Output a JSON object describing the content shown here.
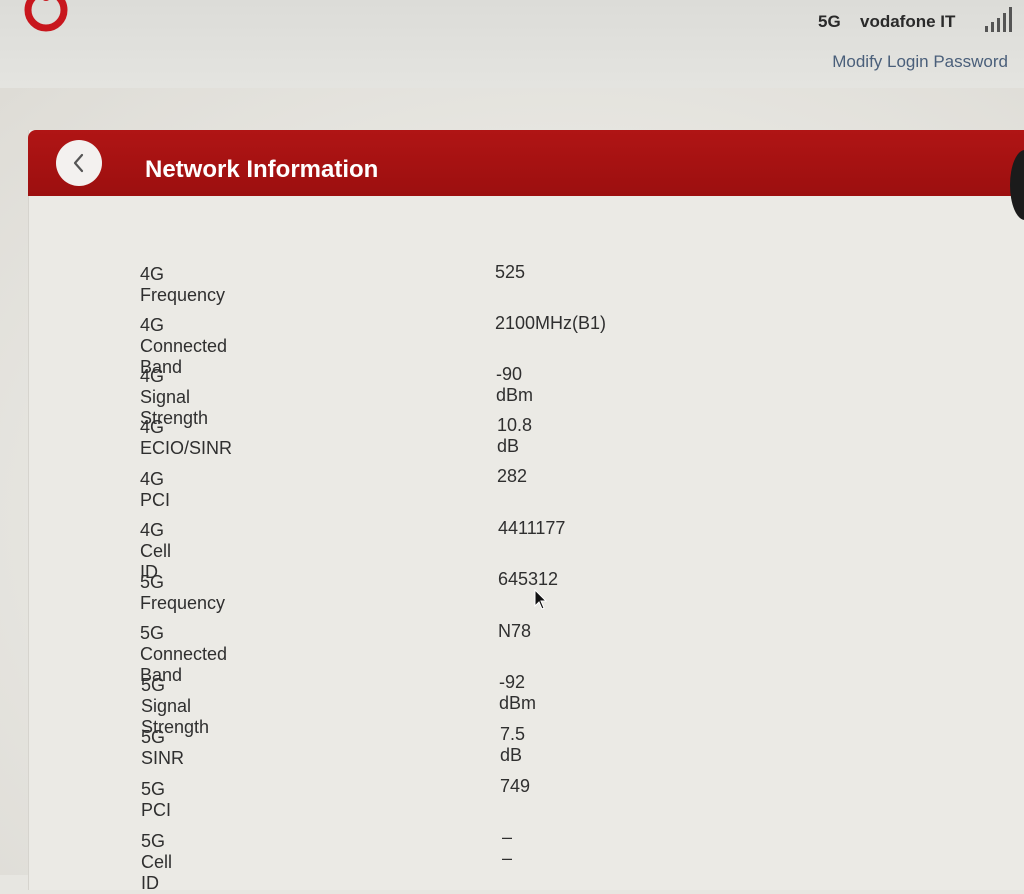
{
  "header": {
    "network_mode": "5G",
    "carrier": "vodafone IT",
    "modify_password_label": "Modify Login Password"
  },
  "panel": {
    "title": "Network Information"
  },
  "info_rows": [
    {
      "label": "4G Frequency",
      "value": "525"
    },
    {
      "label": "4G Connected Band",
      "value": "2100MHz(B1)"
    },
    {
      "label": "4G Signal Strength",
      "value": "-90 dBm"
    },
    {
      "label": "4G ECIO/SINR",
      "value": "10.8 dB"
    },
    {
      "label": "4G PCI",
      "value": "282"
    },
    {
      "label": "4G Cell ID",
      "value": "4411177"
    },
    {
      "label": "5G Frequency",
      "value": "645312"
    },
    {
      "label": "5G Connected Band",
      "value": "N78"
    },
    {
      "label": "5G Signal Strength",
      "value": "-92 dBm"
    },
    {
      "label": "5G SINR",
      "value": "7.5 dB"
    },
    {
      "label": "5G PCI",
      "value": "749"
    },
    {
      "label": "5G Cell ID",
      "value": "– –"
    }
  ],
  "colors": {
    "brand_red": "#b01515",
    "link_blue": "#4a5f7a"
  },
  "icons": {
    "logo": "vodafone-logo-icon",
    "signal": "signal-bars-icon",
    "back": "chevron-left-icon"
  }
}
